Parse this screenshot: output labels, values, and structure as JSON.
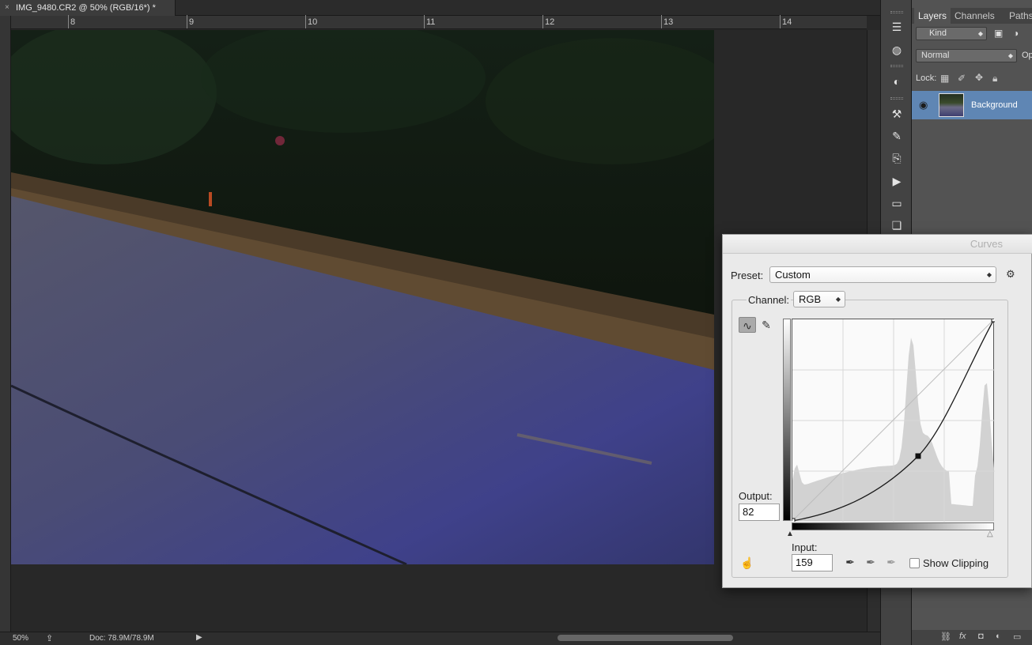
{
  "document": {
    "tab_title": "IMG_9480.CR2 @ 50% (RGB/16*) *",
    "close_glyph": "×",
    "ruler_marks": [
      "8",
      "9",
      "10",
      "11",
      "12",
      "13",
      "14"
    ]
  },
  "status": {
    "zoom": "50%",
    "doc_size": "Doc: 78.9M/78.9M"
  },
  "layers_panel": {
    "tabs": [
      "Layers",
      "Channels",
      "Paths"
    ],
    "filter_kind": "Kind",
    "blend_mode": "Normal",
    "opacity_label": "Op",
    "lock_label": "Lock:",
    "layers": [
      {
        "name": "Background",
        "selected": true,
        "visible": true
      }
    ]
  },
  "curves": {
    "title": "Curves",
    "preset_label": "Preset:",
    "preset_value": "Custom",
    "channel_label": "Channel:",
    "channel_value": "RGB",
    "output_label": "Output:",
    "output_value": "82",
    "input_label": "Input:",
    "input_value": "159",
    "show_clipping_label": "Show Clipping",
    "show_clipping_checked": false,
    "curve_points": [
      [
        0,
        0
      ],
      [
        159,
        82
      ],
      [
        255,
        255
      ]
    ],
    "selected_point": [
      159,
      82
    ],
    "curve_color": "#1a1a1a",
    "histogram_color": "#d0d0d0"
  },
  "colors": {
    "selection_blue": "#5f86b4",
    "panel_bg": "#535353",
    "app_bg": "#282828"
  }
}
